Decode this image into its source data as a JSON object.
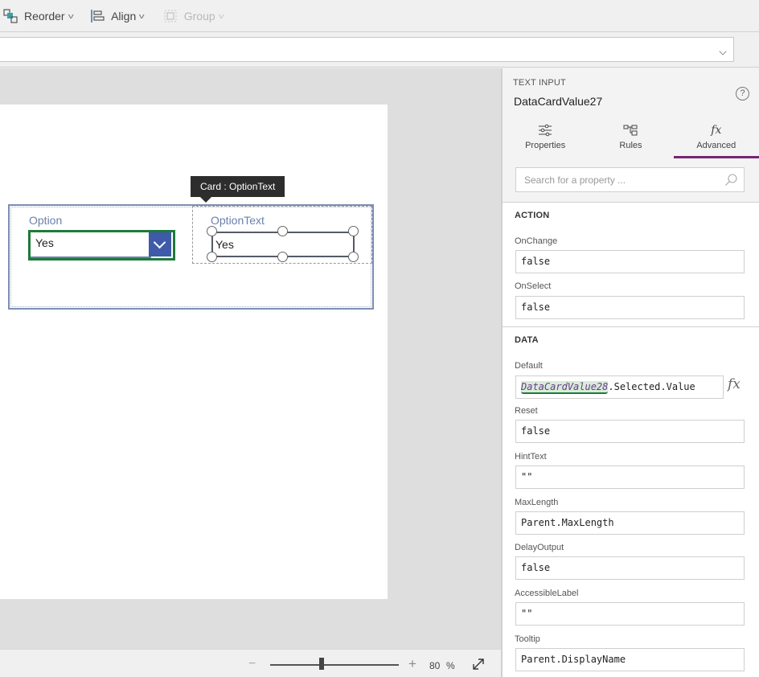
{
  "toolbar": {
    "reorder_label": "Reorder",
    "align_label": "Align",
    "group_label": "Group"
  },
  "formula_bar": {
    "value": ""
  },
  "canvas": {
    "tooltip": "Card : OptionText",
    "option_card": {
      "label": "Option",
      "dropdown_value": "Yes"
    },
    "optiontext_card": {
      "label": "OptionText",
      "input_value": "Yes"
    }
  },
  "zoom": {
    "minus": "−",
    "plus": "+",
    "value": "80",
    "unit": "%",
    "level_percent": 80
  },
  "panel": {
    "control_type": "TEXT INPUT",
    "control_name": "DataCardValue27",
    "help": "?",
    "tabs": [
      {
        "label": "Properties",
        "icon": "sliders-icon",
        "active": false
      },
      {
        "label": "Rules",
        "icon": "rules-icon",
        "active": false
      },
      {
        "label": "Advanced",
        "icon": "fx-icon",
        "active": true
      }
    ],
    "fx_glyph": "fx",
    "search_placeholder": "Search for a property ...",
    "sections": {
      "action": {
        "title": "ACTION",
        "props": [
          {
            "name": "OnChange",
            "value": "false"
          },
          {
            "name": "OnSelect",
            "value": "false"
          }
        ]
      },
      "data": {
        "title": "DATA",
        "default": {
          "name": "Default",
          "ref": "DataCardValue28",
          "rest": ".Selected.Value"
        },
        "props": [
          {
            "name": "Reset",
            "value": "false"
          },
          {
            "name": "HintText",
            "value": "\"\""
          },
          {
            "name": "MaxLength",
            "value": "Parent.MaxLength"
          },
          {
            "name": "DelayOutput",
            "value": "false"
          },
          {
            "name": "AccessibleLabel",
            "value": "\"\""
          },
          {
            "name": "Tooltip",
            "value": "Parent.DisplayName"
          }
        ]
      }
    }
  },
  "colors": {
    "accent_purple": "#742774",
    "selection_green": "#1e7a3c",
    "dropdown_blue": "#3f5aa8",
    "card_label_blue": "#6b80ad"
  }
}
